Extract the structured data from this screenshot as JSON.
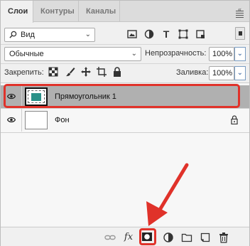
{
  "tabs": [
    {
      "label": "Слои"
    },
    {
      "label": "Контуры"
    },
    {
      "label": "Каналы"
    }
  ],
  "tab_bar": {
    "collapse_glyph": "«"
  },
  "filter": {
    "kind_label": "Вид",
    "icons": [
      "image-filter-icon",
      "adjustment-filter-icon",
      "type-filter-icon",
      "shape-filter-icon",
      "smart-object-filter-icon"
    ]
  },
  "blend": {
    "mode": "Обычные",
    "opacity_label": "Непрозрачность:",
    "opacity_value": "100%"
  },
  "lock": {
    "label": "Закрепить:",
    "fill_label": "Заливка:",
    "fill_value": "100%"
  },
  "layers": [
    {
      "name": "Прямоугольник 1",
      "selected": true,
      "thumbnail_color": "#2a9188"
    },
    {
      "name": "Фон",
      "selected": false,
      "locked": true
    }
  ],
  "bottom_toolbar": {
    "fx_label": "fx",
    "icons": [
      "link-layers-icon",
      "layer-style-icon",
      "add-mask-icon",
      "adjustment-layer-icon",
      "new-group-icon",
      "new-layer-icon",
      "delete-layer-icon"
    ]
  },
  "colors": {
    "highlight": "#e0322a",
    "selected_layer": "#b0b0b0",
    "shape_fill": "#2a9188"
  }
}
